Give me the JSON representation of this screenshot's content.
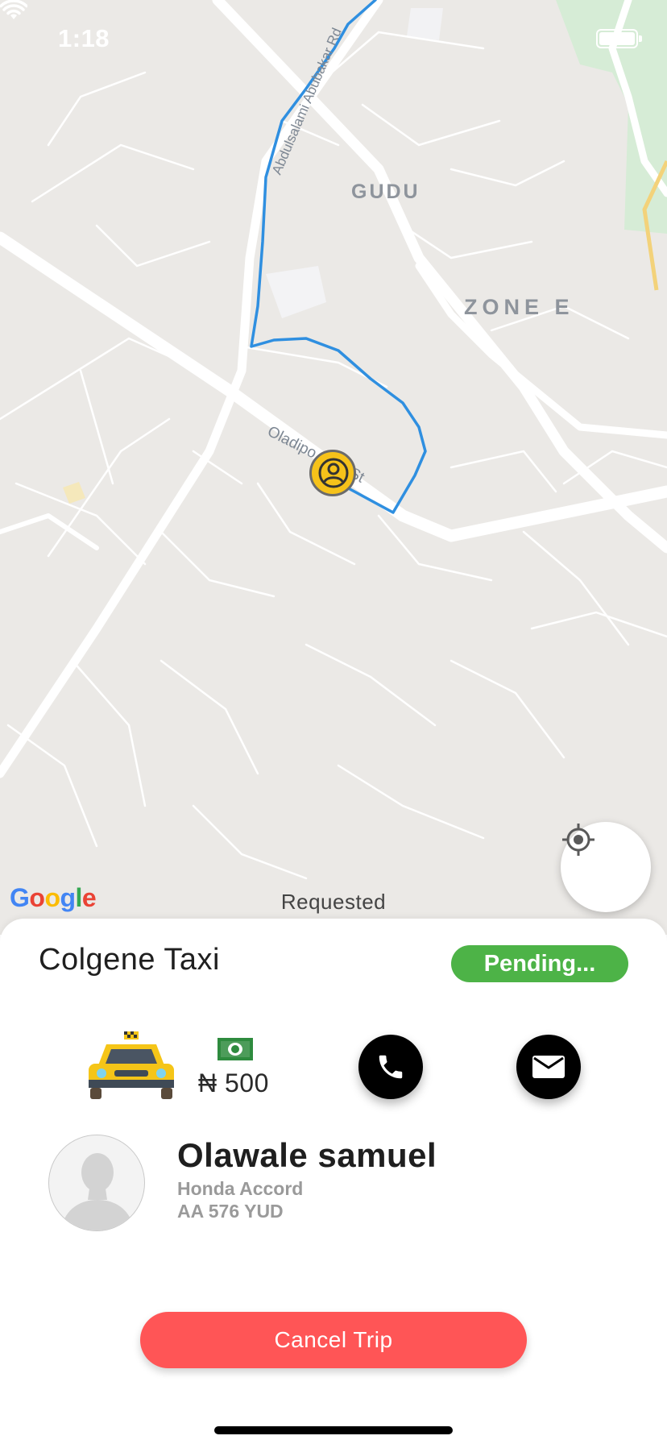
{
  "status_bar": {
    "time": "1:18"
  },
  "map": {
    "area_labels": [
      "GUDU",
      "ZONE E"
    ],
    "road_labels": [
      "Abdulsalami Abubakar Rd",
      "Oladipo Diya St"
    ],
    "attribution": "Google",
    "trip_state": "Requested",
    "route_color": "#2f8fe0",
    "marker_color": "#f6c21a"
  },
  "trip": {
    "service_name": "Colgene Taxi",
    "status": "Pending...",
    "status_color": "#4db347",
    "fare": "₦ 500",
    "payment_icon": "cash-icon"
  },
  "driver": {
    "name": "Olawale samuel",
    "vehicle_model": "Honda Accord",
    "plate": "AA 576 YUD"
  },
  "actions": {
    "call_icon": "phone-icon",
    "message_icon": "mail-icon",
    "cancel_label": "Cancel Trip",
    "cancel_color": "#ff5556"
  }
}
